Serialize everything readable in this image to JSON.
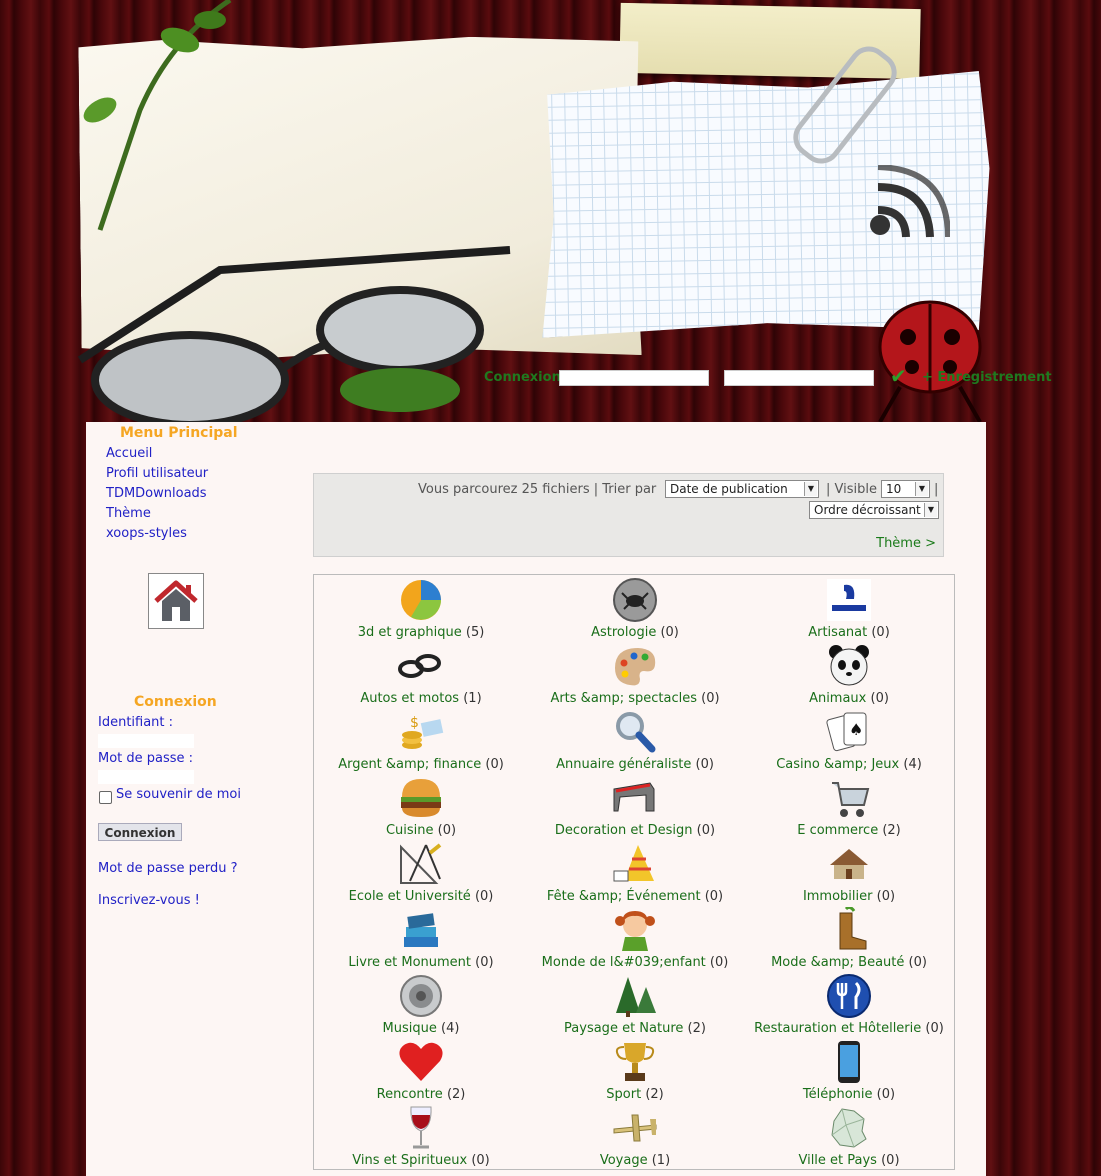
{
  "header": {
    "login_label": "Connexion",
    "register_label": "Enregistrement"
  },
  "sidebar": {
    "menu_title": "Menu Principal",
    "menu_items": [
      {
        "label": "Accueil"
      },
      {
        "label": "Profil utilisateur"
      },
      {
        "label": "TDMDownloads"
      },
      {
        "label": "Thème"
      },
      {
        "label": "xoops-styles"
      }
    ],
    "login": {
      "title": "Connexion",
      "username_label": "Identifiant :",
      "password_label": "Mot de passe :",
      "remember_label": "Se souvenir de moi",
      "submit_label": "Connexion",
      "lost_password": "Mot de passe perdu ?",
      "register": "Inscrivez-vous !"
    }
  },
  "sortbar": {
    "browse_text": "Vous parcourez 25 fichiers | Trier par",
    "sort_select": "Date de publication",
    "visible_text": "| Visible",
    "visible_select": "10",
    "pipe_end": "|",
    "order_select": "Ordre décroissant",
    "theme_link": "Thème >"
  },
  "categories": [
    {
      "name": "3d et graphique",
      "count": "(5)",
      "icon": "pie-chart-icon"
    },
    {
      "name": "Astrologie",
      "count": "(0)",
      "icon": "crab-zodiac-icon"
    },
    {
      "name": "Artisanat",
      "count": "(0)",
      "icon": "artisan-logo-icon"
    },
    {
      "name": "Autos et motos",
      "count": "(1)",
      "icon": "chain-icon"
    },
    {
      "name": "Arts &amp; spectacles",
      "count": "(0)",
      "icon": "palette-icon"
    },
    {
      "name": "Animaux",
      "count": "(0)",
      "icon": "panda-icon"
    },
    {
      "name": "Argent &amp; finance",
      "count": "(0)",
      "icon": "coins-icon"
    },
    {
      "name": "Annuaire généraliste",
      "count": "(0)",
      "icon": "magnifier-icon"
    },
    {
      "name": "Casino &amp; Jeux",
      "count": "(4)",
      "icon": "playing-cards-icon"
    },
    {
      "name": "Cuisine",
      "count": "(0)",
      "icon": "burger-icon"
    },
    {
      "name": "Decoration et Design",
      "count": "(0)",
      "icon": "design-chair-icon"
    },
    {
      "name": "E commerce",
      "count": "(2)",
      "icon": "shopping-cart-icon"
    },
    {
      "name": "Ecole et Université",
      "count": "(0)",
      "icon": "drawing-tools-icon"
    },
    {
      "name": "Fête &amp; Événement",
      "count": "(0)",
      "icon": "party-hat-icon"
    },
    {
      "name": "Immobilier",
      "count": "(0)",
      "icon": "house-icon"
    },
    {
      "name": "Livre et Monument",
      "count": "(0)",
      "icon": "books-icon"
    },
    {
      "name": "Monde de l&#039;enfant",
      "count": "(0)",
      "icon": "girl-icon"
    },
    {
      "name": "Mode &amp; Beauté",
      "count": "(0)",
      "icon": "boot-icon"
    },
    {
      "name": "Musique",
      "count": "(4)",
      "icon": "speaker-icon"
    },
    {
      "name": "Paysage et Nature",
      "count": "(2)",
      "icon": "trees-icon"
    },
    {
      "name": "Restauration et Hôtellerie",
      "count": "(0)",
      "icon": "fork-knife-icon"
    },
    {
      "name": "Rencontre",
      "count": "(2)",
      "icon": "heart-icon"
    },
    {
      "name": "Sport",
      "count": "(2)",
      "icon": "trophy-icon"
    },
    {
      "name": "Téléphonie",
      "count": "(0)",
      "icon": "mobile-phone-icon"
    },
    {
      "name": "Vins et Spiritueux",
      "count": "(0)",
      "icon": "wine-glass-icon"
    },
    {
      "name": "Voyage",
      "count": "(1)",
      "icon": "airplane-icon"
    },
    {
      "name": "Ville et Pays",
      "count": "(0)",
      "icon": "map-icon"
    }
  ]
}
